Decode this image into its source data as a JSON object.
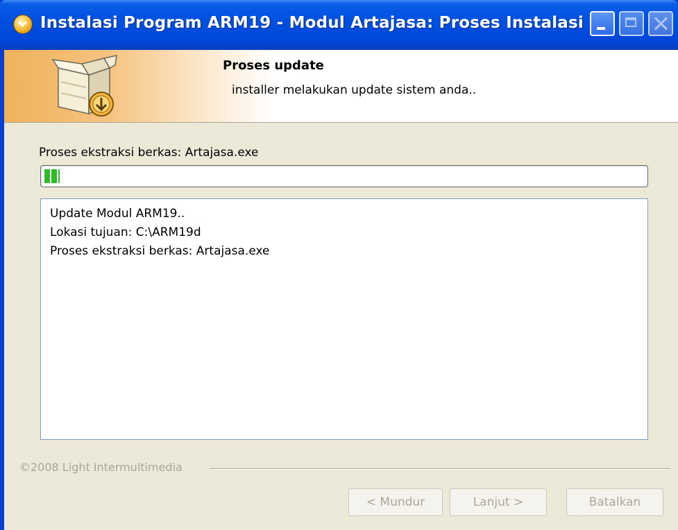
{
  "window": {
    "title": "Instalasi Program ARM19 - Modul Artajasa: Proses Instalasi",
    "title_icon": "installer-icon",
    "controls": [
      "minimize",
      "maximize",
      "close"
    ],
    "titlebar_color": "#0050e0"
  },
  "header": {
    "title": "Proses update",
    "subtitle": "installer melakukan update sistem anda..",
    "icon": "box-download-icon",
    "accent_color": "#f0b25c"
  },
  "status": {
    "label": "Proses ekstraksi berkas: Artajasa.exe",
    "progress_percent": 2.5,
    "progress_color": "#2dbb2a"
  },
  "log": {
    "lines": [
      "Update Modul ARM19..",
      "Lokasi tujuan: C:\\ARM19d",
      "Proses ekstraksi berkas: Artajasa.exe"
    ]
  },
  "footer": {
    "copyright": "©2008 Light Intermultimedia"
  },
  "buttons": {
    "back": "< Mundur",
    "next": "Lanjut >",
    "cancel": "Batalkan"
  }
}
